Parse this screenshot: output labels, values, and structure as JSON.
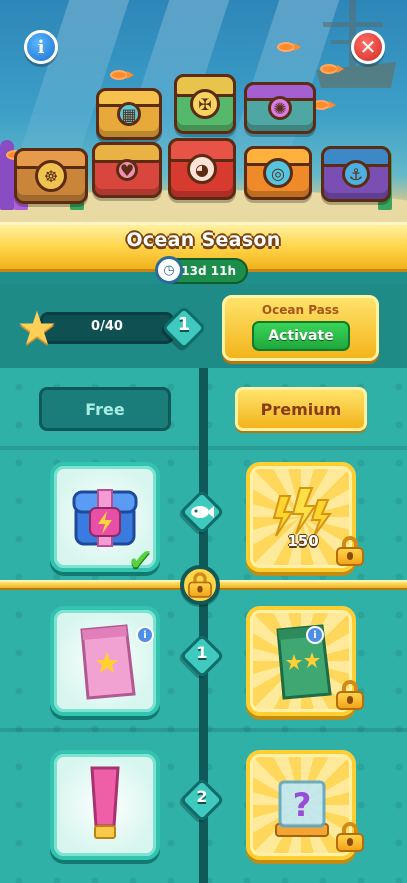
{
  "header": {
    "info_button": "i",
    "close_button": "✕"
  },
  "season": {
    "title": "Ocean Season",
    "time_left": "13d 11h"
  },
  "progress": {
    "text": "0/40",
    "current": 0,
    "goal": 40,
    "level": "1"
  },
  "ocean_pass": {
    "title": "Ocean Pass",
    "button": "Activate"
  },
  "tabs": {
    "free": "Free",
    "premium": "Premium"
  },
  "rows": [
    {
      "level_marker": "fish-icon",
      "free": {
        "reward": "booster-chest",
        "claimed": true
      },
      "premium": {
        "reward": "lightning-boosters",
        "amount": "150",
        "locked": true
      }
    },
    {
      "level_marker": "1",
      "free": {
        "reward": "one-star-card-pack",
        "info": "i"
      },
      "premium": {
        "reward": "two-star-card-pack",
        "info": "i",
        "locked": true
      }
    },
    {
      "level_marker": "2",
      "free": {
        "reward": "pink-tube"
      },
      "premium": {
        "reward": "mystery-box",
        "locked": true
      }
    }
  ],
  "colors": {
    "banner_gold": "#ffd54a",
    "teal_bg": "#2fb1a8",
    "activate_green": "#1fa83b",
    "close_red": "#d02a22",
    "info_blue": "#1c6fd0"
  }
}
